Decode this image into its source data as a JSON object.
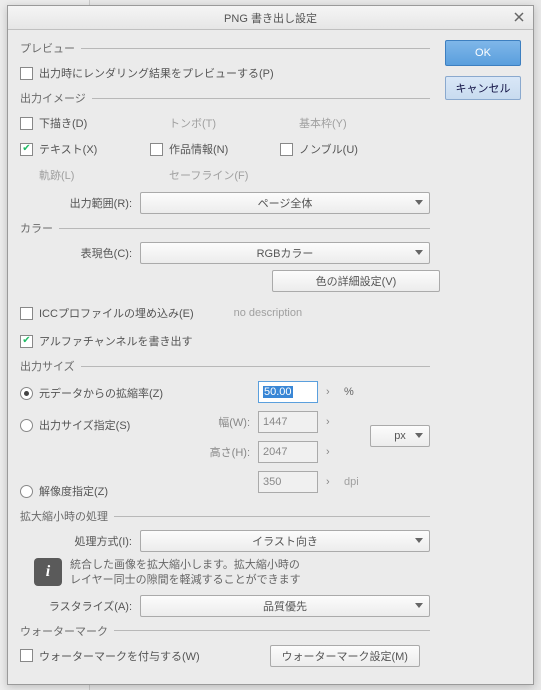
{
  "title": "PNG 書き出し設定",
  "buttons": {
    "ok": "OK",
    "cancel": "キャンセル"
  },
  "preview": {
    "legend": "プレビュー",
    "show": "出力時にレンダリング結果をプレビューする(P)"
  },
  "image": {
    "legend": "出力イメージ",
    "draft": "下描き(D)",
    "text": "テキスト(X)",
    "traj": "軌跡(L)",
    "crop": "トンボ(T)",
    "info": "作品情報(N)",
    "safe": "セーフライン(F)",
    "base": "基本枠(Y)",
    "nombre": "ノンブル(U)",
    "range_label": "出力範囲(R):",
    "range_value": "ページ全体"
  },
  "color": {
    "legend": "カラー",
    "expr_label": "表現色(C):",
    "expr_value": "RGBカラー",
    "detail_btn": "色の詳細設定(V)",
    "icc": "ICCプロファイルの埋め込み(E)",
    "icc_desc": "no description",
    "alpha": "アルファチャンネルを書き出す"
  },
  "size": {
    "legend": "出力サイズ",
    "scale": "元データからの拡縮率(Z)",
    "specify": "出力サイズ指定(S)",
    "res": "解像度指定(Z)",
    "width_l": "幅(W):",
    "height_l": "高さ(H):",
    "scale_v": "50.00",
    "width_v": "1447",
    "height_v": "2047",
    "dpi_v": "350",
    "pct": "%",
    "px": "px",
    "dpi": "dpi"
  },
  "scaling": {
    "legend": "拡大縮小時の処理",
    "method_label": "処理方式(I):",
    "method_value": "イラスト向き",
    "info1": "統合した画像を拡大縮小します。拡大縮小時の",
    "info2": "レイヤー同士の隙間を軽減することができます",
    "raster_label": "ラスタライズ(A):",
    "raster_value": "品質優先"
  },
  "watermark": {
    "legend": "ウォーターマーク",
    "apply": "ウォーターマークを付与する(W)",
    "settings": "ウォーターマーク設定(M)"
  }
}
